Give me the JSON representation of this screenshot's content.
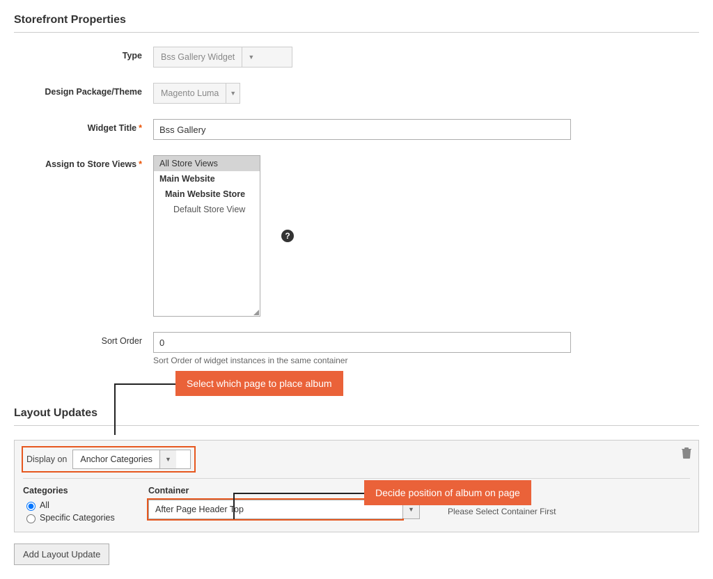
{
  "section1_title": "Storefront Properties",
  "section2_title": "Layout Updates",
  "labels": {
    "type": "Type",
    "theme": "Design Package/Theme",
    "widget_title": "Widget Title",
    "store_views": "Assign to Store Views",
    "sort_order": "Sort Order",
    "display_on": "Display on",
    "categories": "Categories",
    "container": "Container"
  },
  "values": {
    "type": "Bss Gallery Widget",
    "theme": "Magento Luma",
    "widget_title": "Bss Gallery",
    "sort_order": "0",
    "display_on": "Anchor Categories",
    "container": "After Page Header Top"
  },
  "store_views": {
    "all": "All Store Views",
    "main_website": "Main Website",
    "main_store": "Main Website Store",
    "default_view": "Default Store View"
  },
  "notes": {
    "sort_order": "Sort Order of widget instances in the same container",
    "template": "Please Select Container First"
  },
  "radios": {
    "all": "All",
    "specific": "Specific Categories"
  },
  "buttons": {
    "add_layout": "Add Layout Update"
  },
  "callouts": {
    "page": "Select which page to place album",
    "position": "Decide position of album on page"
  }
}
